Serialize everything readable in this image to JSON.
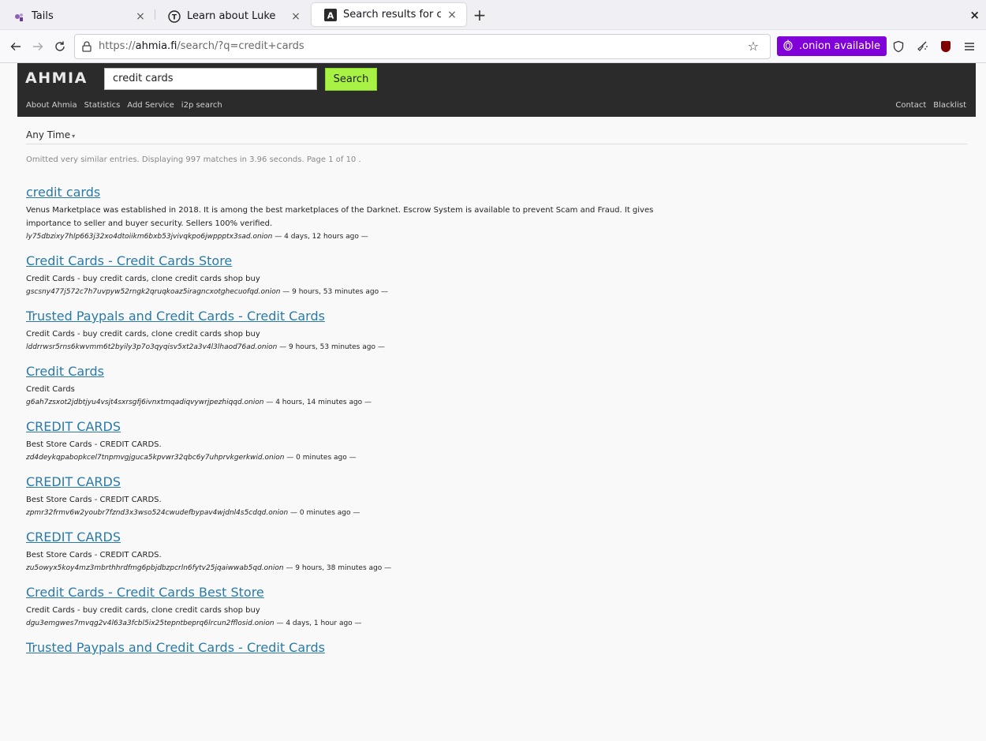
{
  "browser": {
    "tabs": [
      {
        "label": "Tails",
        "icon": "tails-icon",
        "close": "×",
        "active": false
      },
      {
        "label": "Learn about Luke",
        "icon": "T",
        "close": "×",
        "active": false
      },
      {
        "label": "Search results for credit ca",
        "icon": "A",
        "close": "×",
        "active": true
      }
    ],
    "new_tab": "+",
    "window_close": "×",
    "url_host": "ahmia.fi",
    "url_prefix": "https://",
    "url_path": "/search/?q=credit+cards",
    "onion_label": ".onion available",
    "onion_color": "#8000d7"
  },
  "ahmia": {
    "logo": "AHMIA",
    "search_value": "credit cards",
    "search_button": "Search",
    "nav_left": [
      "About Ahmia",
      "Statistics",
      "Add Service",
      "i2p search"
    ],
    "nav_right": [
      "Contact",
      "Blacklist"
    ],
    "filter": "Any Time",
    "filter_caret": "▾",
    "summary": "Omitted very similar entries. Displaying 997 matches in 3.96 seconds. Page 1 of 10 ."
  },
  "results": [
    {
      "title": "credit cards",
      "desc": "Venus Marketplace was established in 2018. It is among the best marketplaces of the Darknet. Escrow System is available to prevent Scam and Fraud. It gives importance to seller and buyer security. Sellers 100% verified.",
      "onion": "ly75dbzixy7hlp663j32xo4dtoiikm6bxb53jvivqkpo6jwppptx3sad.onion",
      "age": " — 4 days, 12 hours ago —"
    },
    {
      "title": "Credit Cards - Credit Cards Store",
      "desc": "Credit Cards - buy credit cards, clone credit cards shop buy",
      "onion": "gscsny477j572c7h7uvpyw52rngk2qruqkoaz5iragncxotghecuofqd.onion",
      "age": " — 9 hours, 53 minutes ago —"
    },
    {
      "title": "Trusted Paypals and Credit Cards - Credit Cards",
      "desc": "Credit Cards - buy credit cards, clone credit cards shop buy",
      "onion": "lddrrwsr5rns6kwvmm6t2byily3p7o3qyqisv5xt2a3v4l3lhaod76ad.onion",
      "age": " — 9 hours, 53 minutes ago —"
    },
    {
      "title": "Credit Cards",
      "desc": "Credit Cards",
      "onion": "g6ah7zsxot2jdbtjyu4vsjt4sxrsgfj6ivnxtmqadiqvywrjpezhiqqd.onion",
      "age": " — 4 hours, 14 minutes ago —"
    },
    {
      "title": "CREDIT CARDS",
      "desc": "Best Store Cards - CREDIT CARDS.",
      "onion": "zd4deykqpabopkcel7tnpmvgjguca5kpvwr32qbc6y7uhprvkgerkwid.onion",
      "age": " — 0 minutes ago —"
    },
    {
      "title": "CREDIT CARDS",
      "desc": "Best Store Cards - CREDIT CARDS.",
      "onion": "zpmr32frmv6w2youbr7fznd3x3wso524cwudefbypav4wjdnl4s5cdqd.onion",
      "age": " — 0 minutes ago —"
    },
    {
      "title": "CREDIT CARDS",
      "desc": "Best Store Cards - CREDIT CARDS.",
      "onion": "zu5owyx5koy4mz3mbrthhrdfmg6pbjdbzpcrln6fytv25jqaiwwab5qd.onion",
      "age": " — 9 hours, 38 minutes ago —"
    },
    {
      "title": "Credit Cards - Credit Cards Best Store",
      "desc": "Credit Cards - buy credit cards, clone credit cards shop buy",
      "onion": "dgu3emgwes7mvqg2v4l63a3fcbl5ix25tepntbeprq6lrcun2fflosid.onion",
      "age": " — 4 days, 1 hour ago —"
    },
    {
      "title": "Trusted Paypals and Credit Cards - Credit Cards",
      "desc": "",
      "onion": "",
      "age": ""
    }
  ]
}
